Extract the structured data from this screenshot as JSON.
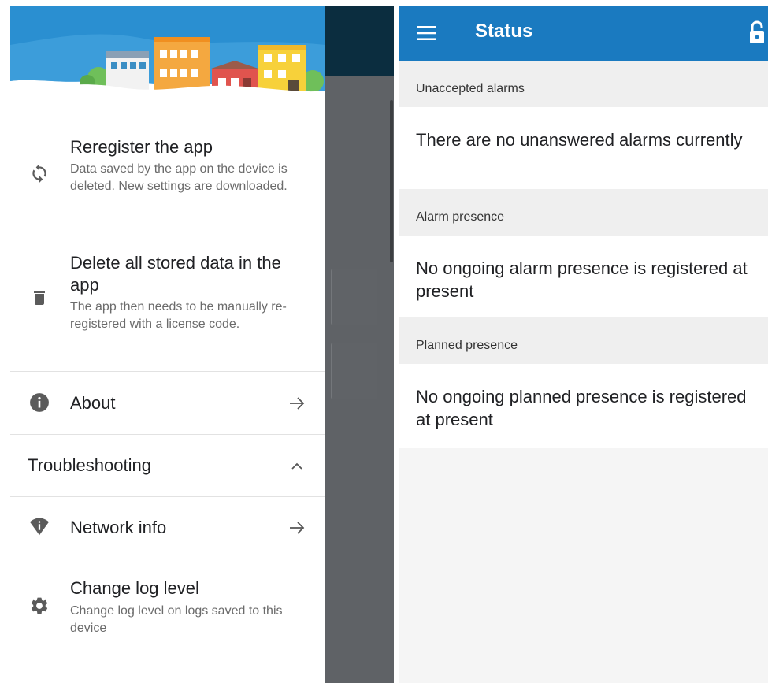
{
  "drawer": {
    "items": [
      {
        "title": "Reregister the app",
        "subtitle": "Data saved by the app on the device is deleted. New settings are downloaded.",
        "icon": "sync-icon"
      },
      {
        "title": "Delete all stored data in the app",
        "subtitle": "The app then needs to be manually re-registered with a license code.",
        "icon": "trash-icon"
      },
      {
        "title": "About",
        "icon": "info-icon",
        "trailing": "arrow-right-icon"
      },
      {
        "title": "Troubleshooting",
        "trailing": "chevron-up-icon"
      },
      {
        "title": "Network info",
        "icon": "wifi-info-icon",
        "trailing": "arrow-right-icon"
      },
      {
        "title": "Change log level",
        "subtitle": "Change log level on logs saved to this device",
        "icon": "gear-icon"
      }
    ]
  },
  "status": {
    "appbar": {
      "title": "Status",
      "menu_icon": "menu-icon",
      "lock_icon": "unlock-icon"
    },
    "sections": [
      {
        "label": "Unaccepted alarms",
        "message": "There are no unanswered alarms currently"
      },
      {
        "label": "Alarm presence",
        "message": "No ongoing alarm presence is registered at present"
      },
      {
        "label": "Planned presence",
        "message": "No ongoing planned presence is registered at present"
      }
    ]
  },
  "colors": {
    "appbar": "#1a7ac0",
    "scrim": "#5f6266",
    "divider": "#e2e2e2",
    "sky": "#2a8fd1"
  }
}
